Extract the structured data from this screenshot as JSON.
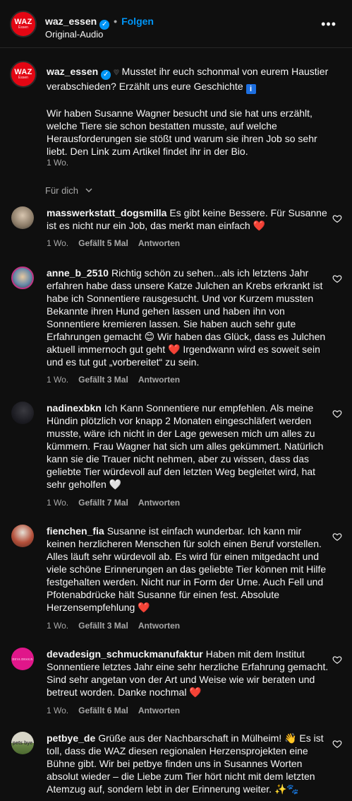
{
  "header": {
    "avatar_text": "WAZ",
    "avatar_subtext": "Essen",
    "username": "waz_essen",
    "verified_mark": "✓",
    "dot": "•",
    "follow_label": "Folgen",
    "audio_label": "Original-Audio",
    "more_label": "•••"
  },
  "caption": {
    "username": "waz_essen",
    "line1": "Musstet ihr euch schonmal von eurem Haustier verabschieden? Erzählt uns eure Geschichte",
    "info_glyph": "i",
    "paragraph": "Wir haben Susanne Wagner besucht und sie hat uns erzählt, welche Tiere sie schon bestatten musste, auf welche Herausforderungen sie stößt und warum sie ihren Job so sehr liebt. Den Link zum Artikel findet ihr in der Bio.",
    "time": "1 Wo."
  },
  "filter_label": "Für dich",
  "comments": [
    {
      "username": "masswerkstatt_dogsmilla",
      "text": "Es gibt keine Bessere. Für Susanne ist es nicht nur ein Job, das merkt man einfach",
      "emoji": "❤️",
      "time": "1 Wo.",
      "likes": "Gefällt 5 Mal",
      "reply": "Antworten"
    },
    {
      "username": "anne_b_2510",
      "text": "Richtig schön zu sehen...als ich letztens Jahr erfahren habe dass unsere Katze Julchen an Krebs erkrankt ist habe ich Sonnentiere rausgesucht. Und vor Kurzem mussten Bekannte ihren Hund gehen lassen und haben ihn von Sonnentiere kremieren lassen. Sie haben auch sehr gute Erfahrungen gemacht",
      "emoji1": "😊",
      "text2": "Wir haben das Glück, dass es Julchen aktuell immernoch gut geht",
      "emoji2": "❤️",
      "text3": "Irgendwann wird es soweit sein und es tut gut „vorbereitet“ zu sein.",
      "time": "1 Wo.",
      "likes": "Gefällt 3 Mal",
      "reply": "Antworten"
    },
    {
      "username": "nadinexbkn",
      "text": "Ich Kann Sonnentiere nur empfehlen. Als meine Hündin plötzlich vor knapp 2 Monaten eingeschläfert werden musste, wäre ich nicht in der Lage gewesen mich um alles zu kümmern. Frau Wagner hat sich um alles gekümmert. Natürlich kann sie die Trauer nicht nehmen, aber zu wissen, dass das geliebte Tier würdevoll auf den letzten Weg begleitet wird, hat sehr geholfen",
      "emoji": "🤍",
      "time": "1 Wo.",
      "likes": "Gefällt 7 Mal",
      "reply": "Antworten"
    },
    {
      "username": "fienchen_fia",
      "text": "Susanne ist einfach wunderbar. Ich kann mir keinen herzlicheren Menschen für solch einen Beruf vorstellen. Alles läuft sehr würdevoll ab. Es wird für einen mitgedacht und viele schöne Erinnerungen an das geliebte Tier können mit Hilfe festgehalten werden. Nicht nur in Form der Urne. Auch Fell und Pfotenabdrücke hält Susanne für einen fest. Absolute Herzensempfehlung",
      "emoji": "❤️",
      "time": "1 Wo.",
      "likes": "Gefällt 3 Mal",
      "reply": "Antworten"
    },
    {
      "username": "devadesign_schmuckmanufaktur",
      "text": "Haben mit dem Institut Sonnentiere letztes Jahr eine sehr herzliche Erfahrung gemacht. Sind sehr angetan von der Art und Weise wie wir beraten und betreut worden. Danke nochmal",
      "emoji": "❤️",
      "avatar_text": "DEVA DESIGN",
      "time": "1 Wo.",
      "likes": "Gefällt 6 Mal",
      "reply": "Antworten"
    },
    {
      "username": "petbye_de",
      "text": "Grüße aus der Nachbarschaft in Mülheim!",
      "emoji1": "👋",
      "text2": "Es ist toll, dass die WAZ diesen regionalen Herzensprojekten eine Bühne gibt. Wir bei petbye finden uns in Susannes Worten absolut wieder – die Liebe zum Tier hört nicht mit dem letzten Atemzug auf, sondern lebt in der Erinnerung weiter.",
      "emoji2": "✨🐾",
      "avatar_text": "pets bye"
    }
  ],
  "colors": {
    "background": "#0f0f0f",
    "accent": "#0095f6",
    "brand_red": "#e30613",
    "muted": "#a8a8a8"
  },
  "icons": [
    "verified-icon",
    "more-icon",
    "info-icon",
    "chevron-down-icon",
    "heart-outline-icon"
  ]
}
